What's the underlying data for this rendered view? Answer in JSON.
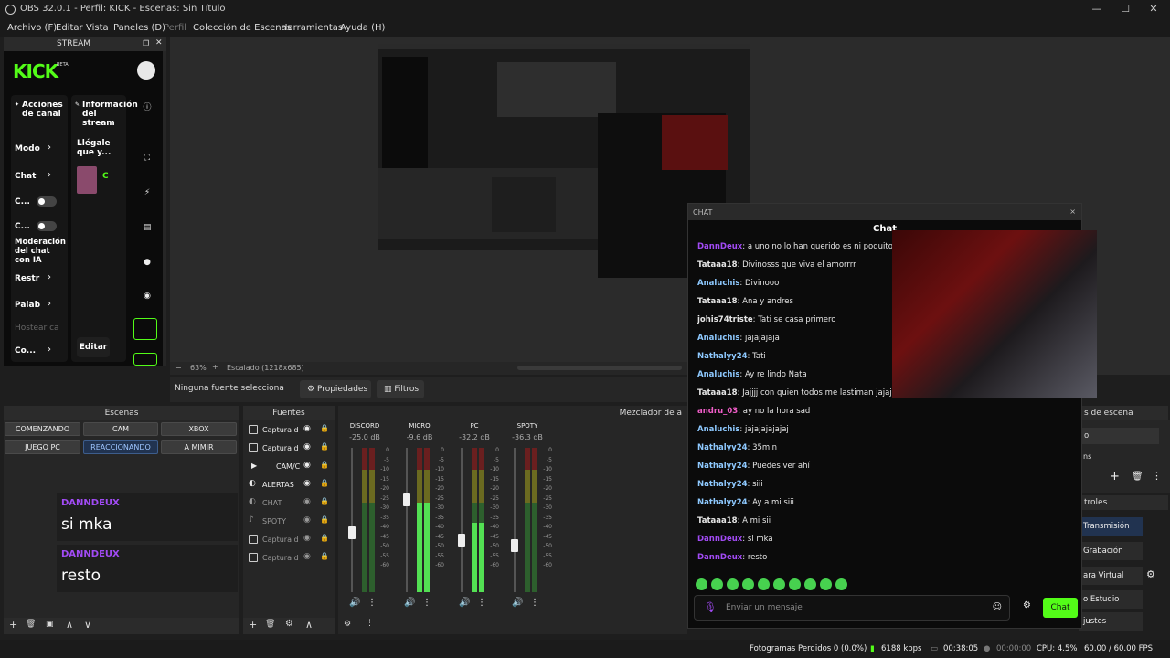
{
  "window": {
    "title": "OBS 32.0.1 - Perfil: KICK - Escenas: Sin Título",
    "min": "—",
    "max": "☐",
    "close": "✕"
  },
  "menu": [
    "Archivo (F)",
    "Editar",
    "Vista",
    "Paneles (D)",
    "Perfil",
    "Colección de Escenas",
    "Herramientas",
    "Ayuda (H)"
  ],
  "dock": {
    "title": "STREAM",
    "logo": "KICK",
    "beta": "BETA",
    "col1_header": "Acciones de canal",
    "col2_header": "Información del stream",
    "col1_items": [
      "Modo",
      "Chat",
      "C...",
      "C...",
      "Moderación del chat con IA",
      "Restr",
      "Palab",
      "Hostear ca",
      "Co..."
    ],
    "col2_title": "Llégale que y...",
    "col2_badge": "C",
    "edit": "Editar"
  },
  "zoom": {
    "value": "63%",
    "minus": "−",
    "plus": "+",
    "scaled": "Escalado (1218x685)"
  },
  "source_bar": {
    "status": "Ninguna fuente selecciona",
    "properties": "Propiedades",
    "filters": "Filtros"
  },
  "scenes": {
    "title": "Escenas",
    "buttons": [
      "COMENZANDO",
      "CAM",
      "XBOX",
      "JUEGO PC",
      "REACCIONANDO",
      "A MIMIR"
    ],
    "active": "REACCIONANDO"
  },
  "chat_cards": [
    {
      "user": "DANNDEUX",
      "message": "si mka"
    },
    {
      "user": "DANNDEUX",
      "message": "resto"
    }
  ],
  "sources": {
    "title": "Fuentes",
    "items": [
      "Captura d",
      "Captura d",
      "CAM/C",
      "ALERTAS",
      "CHAT",
      "SPOTY",
      "Captura d",
      "Captura d"
    ]
  },
  "mixer": {
    "title": "Mezclador de a",
    "channels": [
      {
        "name": "DISCORD",
        "db": "-25.0 dB"
      },
      {
        "name": "MICRO",
        "db": "-9.6 dB"
      },
      {
        "name": "PC",
        "db": "-32.2 dB"
      },
      {
        "name": "SPOTY",
        "db": "-36.3 dB"
      }
    ],
    "scale": [
      "0",
      "-5",
      "-10",
      "-15",
      "-20",
      "-25",
      "-30",
      "-35",
      "-40",
      "-45",
      "-50",
      "-55",
      "-60"
    ]
  },
  "chat_popup": {
    "title": "CHAT",
    "close": "×",
    "header": "Chat",
    "messages": [
      {
        "user": "DannDeux",
        "text": "a uno no lo han querido es ni poquito",
        "color": "#a24bf5"
      },
      {
        "user": "Tataaa18",
        "text": "Divinosss que viva el amorrrr",
        "color": "#e6e6e6"
      },
      {
        "user": "Analuchis",
        "text": "Divinooo",
        "color": "#8ec9ff"
      },
      {
        "user": "Tataaa18",
        "text": "Ana y andres",
        "color": "#e6e6e6"
      },
      {
        "user": "johis74triste",
        "text": "Tati se casa primero",
        "color": "#e6e6e6"
      },
      {
        "user": "Analuchis",
        "text": "jajajajaja",
        "color": "#8ec9ff"
      },
      {
        "user": "Nathalyy24",
        "text": "Tati",
        "color": "#8ec9ff"
      },
      {
        "user": "Analuchis",
        "text": "Ay re lindo Nata",
        "color": "#8ec9ff"
      },
      {
        "user": "Tataaa18",
        "text": "Jajjjj con quien todos me lastiman jajajaaja",
        "color": "#e6e6e6"
      },
      {
        "user": "andru_03",
        "text": "ay no la hora sad",
        "color": "#f05dc8"
      },
      {
        "user": "Analuchis",
        "text": "jajajajajajaj",
        "color": "#8ec9ff"
      },
      {
        "user": "Nathalyy24",
        "text": "35min",
        "color": "#8ec9ff"
      },
      {
        "user": "Nathalyy24",
        "text": "Puedes ver ahí",
        "color": "#8ec9ff"
      },
      {
        "user": "Nathalyy24",
        "text": "siii",
        "color": "#8ec9ff"
      },
      {
        "user": "Nathalyy24",
        "text": "Ay a mi siii",
        "color": "#8ec9ff"
      },
      {
        "user": "Tataaa18",
        "text": "A mi sii",
        "color": "#e6e6e6"
      },
      {
        "user": "DannDeux",
        "text": "si mka",
        "color": "#a24bf5"
      },
      {
        "user": "DannDeux",
        "text": "resto",
        "color": "#a24bf5"
      }
    ],
    "placeholder": "Enviar un mensaje",
    "send": "Chat"
  },
  "transitions": {
    "title": "s de escena",
    "field1": "o",
    "field2": "ns"
  },
  "controls": {
    "title": "troles",
    "buttons": [
      "Transmisión",
      "Grabación",
      "ara Virtual",
      "o Estudio",
      "justes"
    ]
  },
  "status": {
    "dropped": "Fotogramas Perdidos 0 (0.0%)",
    "kbps": "6188 kbps",
    "stream_time": "00:38:05",
    "rec_time": "00:00:00",
    "cpu": "CPU: 4.5%",
    "fps": "60.00 / 60.00 FPS"
  },
  "colors": {
    "kick_green": "#53fc18",
    "purple": "#a24bf5",
    "active_blue": "#213350"
  }
}
